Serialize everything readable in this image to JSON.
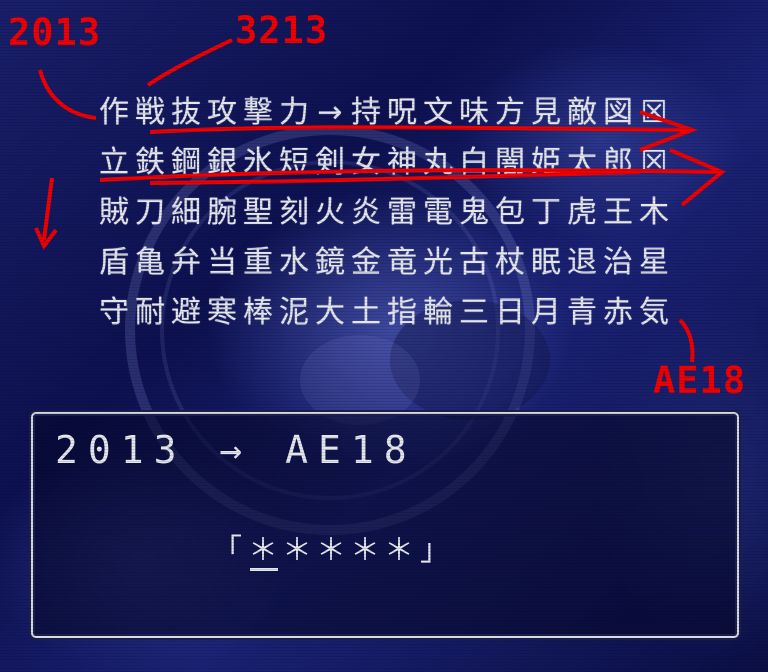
{
  "annotations": {
    "start_code": "2013",
    "middle_code": "3213",
    "end_code": "AE18",
    "color": "#f00000"
  },
  "kanji_rows": [
    [
      "作",
      "戦",
      "抜",
      "攻",
      "撃",
      "力",
      "→",
      "持",
      "呪",
      "文",
      "味",
      "方",
      "見",
      "敵",
      "図",
      "☒"
    ],
    [
      "立",
      "鉄",
      "鋼",
      "銀",
      "氷",
      "短",
      "剣",
      "女",
      "神",
      "丸",
      "白",
      "闇",
      "姫",
      "太",
      "郎",
      "☒"
    ],
    [
      "賊",
      "刀",
      "細",
      "腕",
      "聖",
      "刻",
      "火",
      "炎",
      "雷",
      "電",
      "鬼",
      "包",
      "丁",
      "虎",
      "王",
      "木"
    ],
    [
      "盾",
      "亀",
      "弁",
      "当",
      "重",
      "水",
      "鏡",
      "金",
      "竜",
      "光",
      "古",
      "杖",
      "眠",
      "退",
      "治",
      "星"
    ],
    [
      "守",
      "耐",
      "避",
      "寒",
      "棒",
      "泥",
      "大",
      "土",
      "指",
      "輪",
      "三",
      "日",
      "月",
      "青",
      "赤",
      "気"
    ]
  ],
  "dialog": {
    "title": "2013 → AE18",
    "password_open": "「",
    "password_chars": [
      "＊",
      "＊",
      "＊",
      "＊",
      "＊"
    ],
    "password_close": "」",
    "cursor_index": 0
  },
  "colors": {
    "text": "#e4e6ec",
    "background": "#0d1150",
    "frame": "#d7dbe6"
  }
}
